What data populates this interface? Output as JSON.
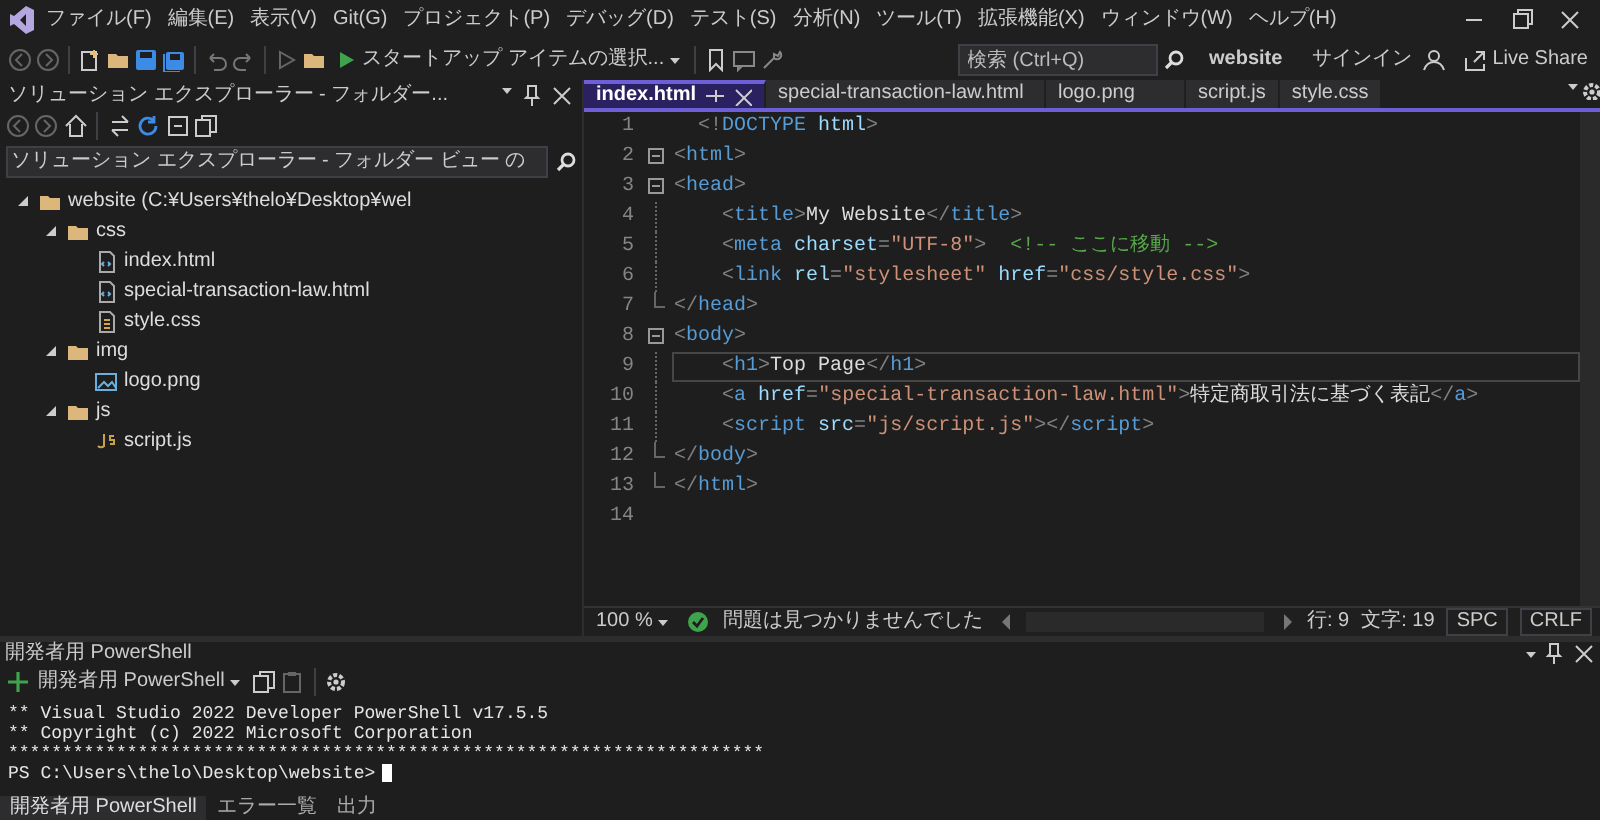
{
  "menu": [
    "ファイル(F)",
    "編集(E)",
    "表示(V)",
    "Git(G)",
    "プロジェクト(P)",
    "デバッグ(D)",
    "テスト(S)",
    "分析(N)",
    "ツール(T)",
    "拡張機能(X)",
    "ウィンドウ(W)",
    "ヘルプ(H)"
  ],
  "search": {
    "placeholder": "検索 (Ctrl+Q)"
  },
  "window": {
    "title": "website"
  },
  "account": {
    "label": "サインイン"
  },
  "toolbar": {
    "start_button": "スタートアップ アイテムの選択...",
    "live_share": "Live Share"
  },
  "explorer": {
    "title": "ソリューション エクスプローラー - フォルダー...",
    "search": {
      "placeholder": "ソリューション エクスプローラー - フォルダー ビュー の"
    },
    "tree": [
      {
        "label": "website (C:¥Users¥thelo¥Desktop¥wel",
        "kind": "folder",
        "expanded": true,
        "children": [
          {
            "label": "css",
            "kind": "folder",
            "expanded": true,
            "children": [
              {
                "label": "index.html",
                "kind": "page"
              },
              {
                "label": "special-transaction-law.html",
                "kind": "page"
              },
              {
                "label": "style.css",
                "kind": "stylesheet"
              }
            ]
          },
          {
            "label": "img",
            "kind": "folder",
            "expanded": true,
            "children": [
              {
                "label": "logo.png",
                "kind": "image"
              }
            ]
          },
          {
            "label": "js",
            "kind": "folder",
            "expanded": true,
            "children": [
              {
                "label": "script.js",
                "kind": "script"
              }
            ]
          }
        ]
      }
    ]
  },
  "editor_tabs": [
    {
      "label": "index.html",
      "selected": true
    },
    {
      "label": "special-transaction-law.html",
      "selected": false
    },
    {
      "label": "logo.png",
      "selected": false
    },
    {
      "label": "script.js",
      "selected": false
    },
    {
      "label": "style.css",
      "selected": false
    }
  ],
  "code_lines": [
    {
      "number": "1",
      "kind": "none",
      "current": false,
      "tokens": [
        {
          "kind": "punct",
          "text": "  <!"
        },
        {
          "kind": "tag",
          "text": "DOCTYPE"
        },
        {
          "kind": "attr",
          "text": " html"
        },
        {
          "kind": "punct",
          "text": ">"
        }
      ]
    },
    {
      "number": "2",
      "kind": "open",
      "current": false,
      "tokens": [
        {
          "kind": "punct",
          "text": "<"
        },
        {
          "kind": "tag",
          "text": "html"
        },
        {
          "kind": "punct",
          "text": ">"
        }
      ]
    },
    {
      "number": "3",
      "kind": "open",
      "current": false,
      "tokens": [
        {
          "kind": "punct",
          "text": "<"
        },
        {
          "kind": "tag",
          "text": "head"
        },
        {
          "kind": "punct",
          "text": ">"
        }
      ]
    },
    {
      "number": "4",
      "kind": "inner",
      "current": false,
      "tokens": [
        {
          "kind": "punct",
          "text": "    <"
        },
        {
          "kind": "tag",
          "text": "title"
        },
        {
          "kind": "punct",
          "text": ">"
        },
        {
          "kind": "text",
          "text": "My Website"
        },
        {
          "kind": "punct",
          "text": "</"
        },
        {
          "kind": "tag",
          "text": "title"
        },
        {
          "kind": "punct",
          "text": ">"
        }
      ]
    },
    {
      "number": "5",
      "kind": "inner",
      "current": false,
      "tokens": [
        {
          "kind": "punct",
          "text": "    <"
        },
        {
          "kind": "tag",
          "text": "meta"
        },
        {
          "kind": "attr",
          "text": " charset"
        },
        {
          "kind": "punct",
          "text": "="
        },
        {
          "kind": "str",
          "text": "\"UTF-8\""
        },
        {
          "kind": "punct",
          "text": ">"
        },
        {
          "kind": "comment",
          "text": "  <!-- ここに移動 -->"
        }
      ]
    },
    {
      "number": "6",
      "kind": "inner",
      "current": false,
      "tokens": [
        {
          "kind": "punct",
          "text": "    <"
        },
        {
          "kind": "tag",
          "text": "link"
        },
        {
          "kind": "attr",
          "text": " rel"
        },
        {
          "kind": "punct",
          "text": "="
        },
        {
          "kind": "str",
          "text": "\"stylesheet\""
        },
        {
          "kind": "attr",
          "text": " href"
        },
        {
          "kind": "punct",
          "text": "="
        },
        {
          "kind": "str",
          "text": "\"css/style.css\""
        },
        {
          "kind": "punct",
          "text": ">"
        }
      ]
    },
    {
      "number": "7",
      "kind": "end",
      "current": false,
      "tokens": [
        {
          "kind": "punct",
          "text": "</"
        },
        {
          "kind": "tag",
          "text": "head"
        },
        {
          "kind": "punct",
          "text": ">"
        }
      ]
    },
    {
      "number": "8",
      "kind": "open",
      "current": false,
      "tokens": [
        {
          "kind": "punct",
          "text": "<"
        },
        {
          "kind": "tag",
          "text": "body"
        },
        {
          "kind": "punct",
          "text": ">"
        }
      ]
    },
    {
      "number": "9",
      "kind": "inner",
      "current": true,
      "tokens": [
        {
          "kind": "punct",
          "text": "    <"
        },
        {
          "kind": "tag",
          "text": "h1"
        },
        {
          "kind": "punct",
          "text": ">"
        },
        {
          "kind": "text",
          "text": "Top Page"
        },
        {
          "kind": "punct",
          "text": "</"
        },
        {
          "kind": "tag",
          "text": "h1"
        },
        {
          "kind": "punct",
          "text": ">"
        }
      ]
    },
    {
      "number": "10",
      "kind": "inner",
      "current": false,
      "tokens": [
        {
          "kind": "punct",
          "text": "    <"
        },
        {
          "kind": "tag",
          "text": "a"
        },
        {
          "kind": "attr",
          "text": " href"
        },
        {
          "kind": "punct",
          "text": "="
        },
        {
          "kind": "str",
          "text": "\"special-transaction-law.html\""
        },
        {
          "kind": "punct",
          "text": ">"
        },
        {
          "kind": "text",
          "text": "特定商取引法に基づく表記"
        },
        {
          "kind": "punct",
          "text": "</"
        },
        {
          "kind": "tag",
          "text": "a"
        },
        {
          "kind": "punct",
          "text": ">"
        }
      ]
    },
    {
      "number": "11",
      "kind": "inner",
      "current": false,
      "tokens": [
        {
          "kind": "punct",
          "text": "    <"
        },
        {
          "kind": "tag",
          "text": "script"
        },
        {
          "kind": "attr",
          "text": " src"
        },
        {
          "kind": "punct",
          "text": "="
        },
        {
          "kind": "str",
          "text": "\"js/script.js\""
        },
        {
          "kind": "punct",
          "text": "></"
        },
        {
          "kind": "tag",
          "text": "script"
        },
        {
          "kind": "punct",
          "text": ">"
        }
      ]
    },
    {
      "number": "12",
      "kind": "end",
      "current": false,
      "tokens": [
        {
          "kind": "punct",
          "text": "</"
        },
        {
          "kind": "tag",
          "text": "body"
        },
        {
          "kind": "punct",
          "text": ">"
        }
      ]
    },
    {
      "number": "13",
      "kind": "end",
      "current": false,
      "tokens": [
        {
          "kind": "punct",
          "text": "</"
        },
        {
          "kind": "tag",
          "text": "html"
        },
        {
          "kind": "punct",
          "text": ">"
        }
      ]
    },
    {
      "number": "14",
      "kind": "none",
      "current": false
    }
  ],
  "editor_status": {
    "zoom": "100 %",
    "issues": "問題は見つかりませんでした",
    "line": "行: 9",
    "column": "文字: 19",
    "whitespace": "SPC",
    "line_ending": "CRLF"
  },
  "terminal": {
    "title": "開発者用 PowerShell",
    "profile": "開発者用 PowerShell",
    "lines": [
      "** Visual Studio 2022 Developer PowerShell v17.5.5",
      "** Copyright (c) 2022 Microsoft Corporation",
      "**********************************************************************"
    ],
    "prompt": "PS C:\\Users\\thelo\\Desktop\\website>"
  },
  "bottom_tabs": [
    {
      "label": "開発者用 PowerShell",
      "selected": true
    },
    {
      "label": "エラー一覧",
      "selected": false
    },
    {
      "label": "出力",
      "selected": false
    }
  ]
}
